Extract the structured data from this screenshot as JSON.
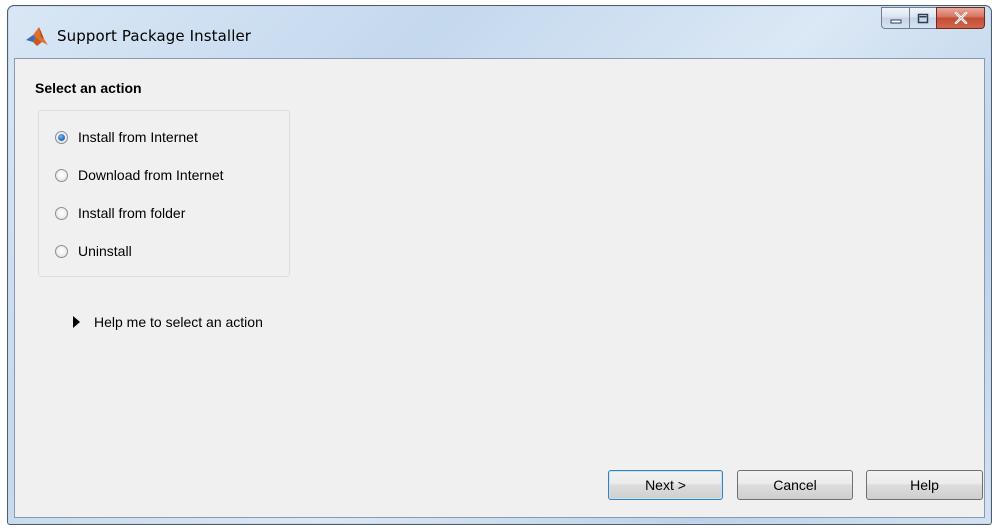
{
  "window": {
    "title": "Support Package Installer",
    "icon": "matlab-logo-icon"
  },
  "caption_buttons": {
    "minimize_icon": "minimize-icon",
    "maximize_icon": "maximize-icon",
    "close_icon": "close-icon"
  },
  "main": {
    "heading": "Select an action",
    "actions": [
      {
        "label": "Install from Internet",
        "selected": true
      },
      {
        "label": "Download from Internet",
        "selected": false
      },
      {
        "label": "Install from folder",
        "selected": false
      },
      {
        "label": "Uninstall",
        "selected": false
      }
    ],
    "help_link": "Help me to select an action"
  },
  "footer": {
    "next_label": "Next >",
    "cancel_label": "Cancel",
    "help_label": "Help"
  },
  "colors": {
    "accent": "#2a6fc0",
    "close_button": "#c24d35"
  }
}
